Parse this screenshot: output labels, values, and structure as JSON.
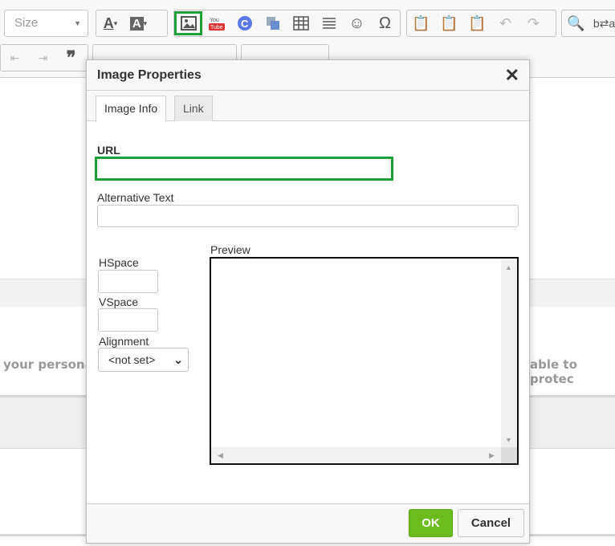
{
  "toolbar": {
    "size_label": "Size",
    "row1_groups": [
      [
        "font-color",
        "background-color"
      ],
      [
        "image",
        "youtube",
        "code-snippet",
        "iframe",
        "table",
        "horizontal-line",
        "smiley",
        "special-char"
      ],
      [
        "paste",
        "paste-text",
        "paste-word",
        "undo",
        "redo"
      ],
      [
        "find",
        "replace"
      ]
    ]
  },
  "background": {
    "left_text": "your persona",
    "right_text": "able to protec"
  },
  "dialog": {
    "title": "Image Properties",
    "tabs": [
      "Image Info",
      "Link"
    ],
    "url_label": "URL",
    "url_value": "",
    "alt_label": "Alternative Text",
    "alt_value": "",
    "hspace_label": "HSpace",
    "vspace_label": "VSpace",
    "alignment_label": "Alignment",
    "alignment_value": "<not set>",
    "preview_label": "Preview",
    "ok_label": "OK",
    "cancel_label": "Cancel"
  },
  "colors": {
    "highlight": "#1fa03a",
    "ok_button": "#6cbc1e"
  }
}
